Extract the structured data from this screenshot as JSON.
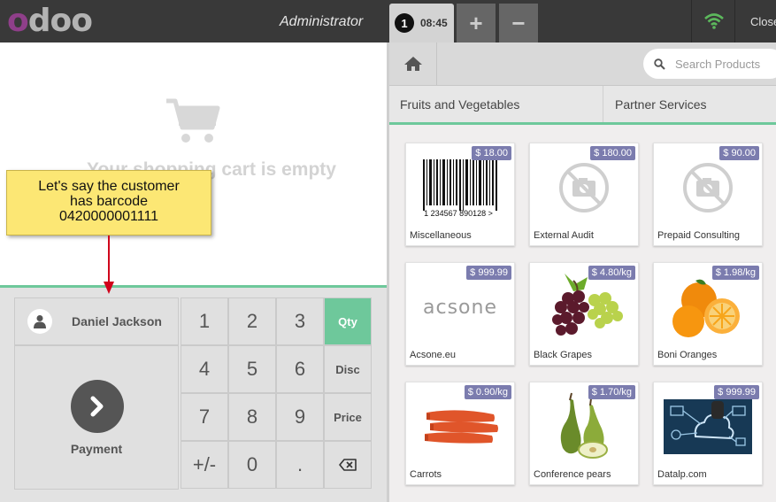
{
  "topbar": {
    "logo_text": "odoo",
    "logo_colors": [
      "#8f3f8a",
      "#b3b3b3",
      "#b3b3b3",
      "#b3b3b3"
    ],
    "user": "Administrator",
    "order_sequence": "1",
    "order_time": "08:45",
    "add_order_label": "+",
    "remove_order_label": "−",
    "close_label": "Close"
  },
  "cart": {
    "empty_text": "Your shopping cart is empty"
  },
  "tooltip": {
    "lines": [
      "Let's say the customer",
      "has barcode",
      "0420000001111"
    ]
  },
  "actionpad": {
    "customer": "Daniel Jackson",
    "payment_label": "Payment"
  },
  "numpad": {
    "keys": [
      "1",
      "2",
      "3",
      "Qty",
      "4",
      "5",
      "6",
      "Disc",
      "7",
      "8",
      "9",
      "Price",
      "+/-",
      "0",
      ".",
      "⌫"
    ],
    "active_mode": "Qty"
  },
  "search": {
    "placeholder": "Search Products"
  },
  "categories": [
    "Fruits and Vegetables",
    "Partner Services"
  ],
  "products": [
    {
      "name": "Miscellaneous",
      "price": "$ 18.00",
      "image": "barcode",
      "barcode_text": "1 234567 890128 >"
    },
    {
      "name": "External Audit",
      "price": "$ 180.00",
      "image": "no-photo"
    },
    {
      "name": "Prepaid Consulting",
      "price": "$ 90.00",
      "image": "no-photo"
    },
    {
      "name": "Acsone.eu",
      "price": "$ 999.99",
      "image": "acsone-logo",
      "logo_text": "acsone"
    },
    {
      "name": "Black Grapes",
      "price": "$ 4.80/kg",
      "image": "grapes"
    },
    {
      "name": "Boni Oranges",
      "price": "$ 1.98/kg",
      "image": "oranges"
    },
    {
      "name": "Carrots",
      "price": "$ 0.90/kg",
      "image": "carrots"
    },
    {
      "name": "Conference pears",
      "price": "$ 1.70/kg",
      "image": "pears"
    },
    {
      "name": "Datalp.com",
      "price": "$ 999.99",
      "image": "datalp"
    }
  ],
  "colors": {
    "accent": "#6ec89b",
    "price_badge": "#7b7cae",
    "topbar": "#393939",
    "tooltip": "#fce774",
    "arrow": "#d0021b",
    "wifi": "#5cb85c"
  }
}
